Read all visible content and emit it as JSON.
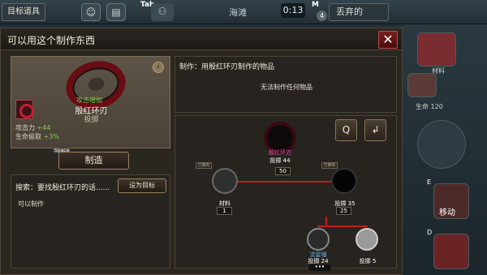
{
  "hud": {
    "target_label": "目标道具",
    "tab_label": "Tab",
    "location": "海滩",
    "time": "0:13",
    "m_label": "M",
    "m_count": "4",
    "discard_label": "丢弃的"
  },
  "dialog": {
    "title": "可以用这个制作东西",
    "close_label": "✕"
  },
  "item": {
    "hint": "攻击增加",
    "name": "殷红环刃",
    "category": "投掷",
    "info_label": "i",
    "stats": [
      {
        "label": "攻击力",
        "value": "+44"
      },
      {
        "label": "生命偷取",
        "value": "+3%"
      }
    ],
    "space_label": "Space",
    "craft_button": "制造"
  },
  "search": {
    "text": "搜索：要找殷红环刃的话......",
    "set_target_button": "设为目标",
    "status": "可以制作"
  },
  "made_with": {
    "title": "制作：用殷红环刃制作的物品",
    "empty_message": "无法制作任何物品"
  },
  "tree": {
    "toolbar": [
      "Q",
      "↲"
    ],
    "root": {
      "name": "殷红环刃",
      "sub": "投掷 44",
      "count": "50"
    },
    "left": {
      "tag": "已拥有",
      "name": "",
      "sub": "材料",
      "count": "1"
    },
    "right": {
      "tag": "已拥有",
      "name": "",
      "sub": "投掷 35",
      "count": "25"
    },
    "bottom_left": {
      "name": "流星锤",
      "sub": "投掷 24"
    },
    "bottom_right": {
      "name": "",
      "sub": "投掷 5"
    },
    "more_label": "•••"
  },
  "right_side": {
    "item_label": "材料",
    "life_label": "生命 120",
    "move_label": "移动",
    "key_e": "E",
    "key_d": "D"
  },
  "colors": {
    "accent": "#bb2020",
    "stat_green": "#7fd24b",
    "panel_border": "#9c8359"
  }
}
